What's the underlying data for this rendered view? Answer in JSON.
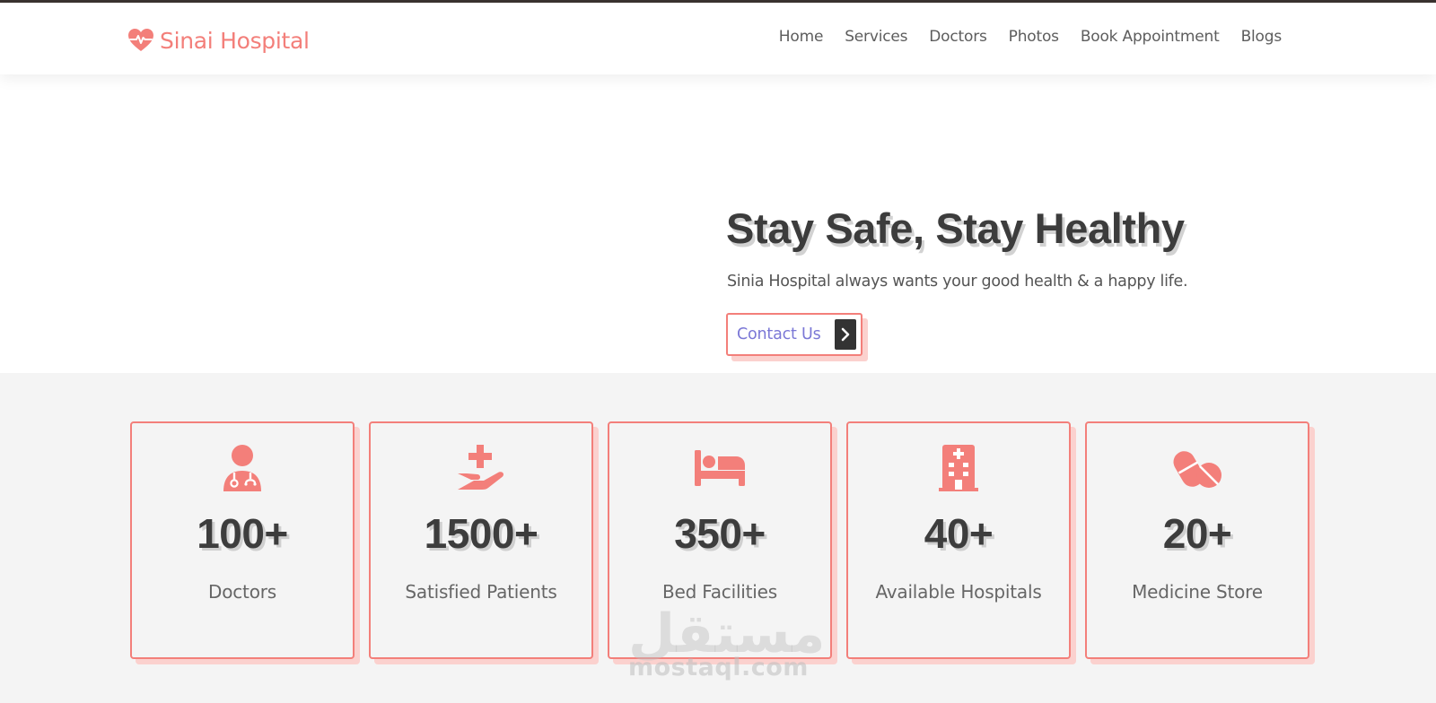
{
  "brand": {
    "name": "Sinai Hospital",
    "accent": "#f37f7a",
    "shadow": "#fbd1ce",
    "icon": "heartbeat-icon"
  },
  "nav": {
    "items": [
      "Home",
      "Services",
      "Doctors",
      "Photos",
      "Book Appointment",
      "Blogs"
    ]
  },
  "hero": {
    "title": "Stay Safe, Stay Healthy",
    "subtitle": "Sinia Hospital always wants your good health & a happy life.",
    "cta_label": "Contact Us",
    "cta_icon": "chevron-right-icon"
  },
  "stats": [
    {
      "icon": "doctor-icon",
      "count": "100+",
      "label": "Doctors"
    },
    {
      "icon": "hand-holding-medical-icon",
      "count": "1500+",
      "label": "Satisfied Patients"
    },
    {
      "icon": "bed-icon",
      "count": "350+",
      "label": "Bed Facilities"
    },
    {
      "icon": "hospital-building-icon",
      "count": "40+",
      "label": "Available Hospitals"
    },
    {
      "icon": "pills-icon",
      "count": "20+",
      "label": "Medicine Store"
    }
  ],
  "watermark": {
    "arabic": "مستقل",
    "latin": "mostaql.com"
  }
}
